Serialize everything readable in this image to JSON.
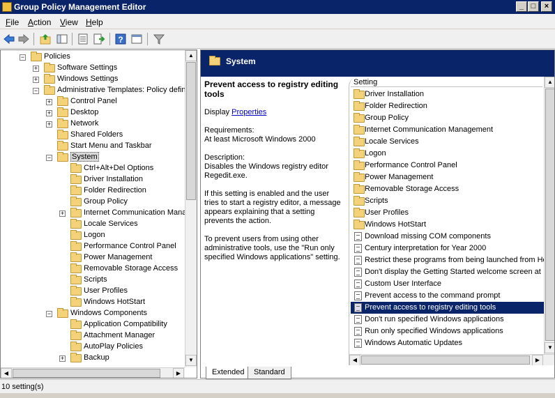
{
  "window": {
    "title": "Group Policy Management Editor"
  },
  "menu": [
    {
      "label": "File"
    },
    {
      "label": "Action"
    },
    {
      "label": "View"
    },
    {
      "label": "Help"
    }
  ],
  "tree": [
    {
      "label": "Policies",
      "depth": 1,
      "expander": "-"
    },
    {
      "label": "Software Settings",
      "depth": 2,
      "expander": "+"
    },
    {
      "label": "Windows Settings",
      "depth": 2,
      "expander": "+"
    },
    {
      "label": "Administrative Templates: Policy defini",
      "depth": 2,
      "expander": "-"
    },
    {
      "label": "Control Panel",
      "depth": 3,
      "expander": "+"
    },
    {
      "label": "Desktop",
      "depth": 3,
      "expander": "+"
    },
    {
      "label": "Network",
      "depth": 3,
      "expander": "+"
    },
    {
      "label": "Shared Folders",
      "depth": 3,
      "expander": ""
    },
    {
      "label": "Start Menu and Taskbar",
      "depth": 3,
      "expander": ""
    },
    {
      "label": "System",
      "depth": 3,
      "expander": "-",
      "selected": true
    },
    {
      "label": "Ctrl+Alt+Del Options",
      "depth": 4,
      "expander": ""
    },
    {
      "label": "Driver Installation",
      "depth": 4,
      "expander": ""
    },
    {
      "label": "Folder Redirection",
      "depth": 4,
      "expander": ""
    },
    {
      "label": "Group Policy",
      "depth": 4,
      "expander": ""
    },
    {
      "label": "Internet Communication Manag",
      "depth": 4,
      "expander": "+"
    },
    {
      "label": "Locale Services",
      "depth": 4,
      "expander": ""
    },
    {
      "label": "Logon",
      "depth": 4,
      "expander": ""
    },
    {
      "label": "Performance Control Panel",
      "depth": 4,
      "expander": ""
    },
    {
      "label": "Power Management",
      "depth": 4,
      "expander": ""
    },
    {
      "label": "Removable Storage Access",
      "depth": 4,
      "expander": ""
    },
    {
      "label": "Scripts",
      "depth": 4,
      "expander": ""
    },
    {
      "label": "User Profiles",
      "depth": 4,
      "expander": ""
    },
    {
      "label": "Windows HotStart",
      "depth": 4,
      "expander": ""
    },
    {
      "label": "Windows Components",
      "depth": 3,
      "expander": "-"
    },
    {
      "label": "Application Compatibility",
      "depth": 4,
      "expander": ""
    },
    {
      "label": "Attachment Manager",
      "depth": 4,
      "expander": ""
    },
    {
      "label": "AutoPlay Policies",
      "depth": 4,
      "expander": ""
    },
    {
      "label": "Backup",
      "depth": 4,
      "expander": "+"
    }
  ],
  "right": {
    "header_title": "System",
    "description": {
      "title": "Prevent access to registry editing tools",
      "display_prefix": "Display",
      "display_link": "Properties",
      "requirements": "Requirements:\nAt least Microsoft Windows 2000",
      "description": "Description:\nDisables the Windows registry editor Regedit.exe.",
      "para1": "If this setting is enabled and the user tries to start a registry editor, a message appears explaining that a setting prevents the action.",
      "para2": "To prevent users from using other administrative tools, use the \"Run only specified Windows applications\" setting."
    },
    "column_header": "Setting",
    "items": [
      {
        "label": "Driver Installation",
        "kind": "folder"
      },
      {
        "label": "Folder Redirection",
        "kind": "folder"
      },
      {
        "label": "Group Policy",
        "kind": "folder"
      },
      {
        "label": "Internet Communication Management",
        "kind": "folder"
      },
      {
        "label": "Locale Services",
        "kind": "folder"
      },
      {
        "label": "Logon",
        "kind": "folder"
      },
      {
        "label": "Performance Control Panel",
        "kind": "folder"
      },
      {
        "label": "Power Management",
        "kind": "folder"
      },
      {
        "label": "Removable Storage Access",
        "kind": "folder"
      },
      {
        "label": "Scripts",
        "kind": "folder"
      },
      {
        "label": "User Profiles",
        "kind": "folder"
      },
      {
        "label": "Windows HotStart",
        "kind": "folder"
      },
      {
        "label": "Download missing COM components",
        "kind": "setting"
      },
      {
        "label": "Century interpretation for Year 2000",
        "kind": "setting"
      },
      {
        "label": "Restrict these programs from being launched from He",
        "kind": "setting"
      },
      {
        "label": "Don't display the Getting Started welcome screen at",
        "kind": "setting"
      },
      {
        "label": "Custom User Interface",
        "kind": "setting"
      },
      {
        "label": "Prevent access to the command prompt",
        "kind": "setting"
      },
      {
        "label": "Prevent access to registry editing tools",
        "kind": "setting",
        "selected": true
      },
      {
        "label": "Don't run specified Windows applications",
        "kind": "setting"
      },
      {
        "label": "Run only specified Windows applications",
        "kind": "setting"
      },
      {
        "label": "Windows Automatic Updates",
        "kind": "setting"
      }
    ]
  },
  "tabs": [
    {
      "label": "Extended",
      "active": true
    },
    {
      "label": "Standard",
      "active": false
    }
  ],
  "status": {
    "text": "10 setting(s)"
  },
  "icons": {
    "back": "back-arrow-icon",
    "forward": "forward-arrow-icon",
    "up": "up-folder-icon",
    "show_hide": "show-hide-tree-icon",
    "properties": "properties-icon",
    "export": "export-list-icon",
    "help": "help-icon",
    "console": "console-icon",
    "filter": "filter-icon"
  }
}
